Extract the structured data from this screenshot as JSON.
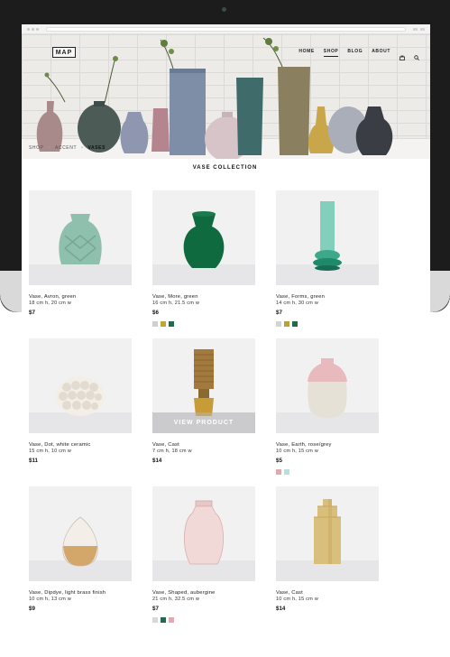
{
  "site": {
    "logo": "MAP",
    "nav": [
      {
        "label": "HOME",
        "active": false
      },
      {
        "label": "SHOP",
        "active": true
      },
      {
        "label": "BLOG",
        "active": false
      },
      {
        "label": "ABOUT",
        "active": false
      }
    ]
  },
  "breadcrumb": [
    "SHOP",
    "ACCENT",
    "VASES"
  ],
  "breadcrumb_sep": "•",
  "collection_title": "VASE COLLECTION",
  "products": [
    {
      "name": "Vase, Avron, green",
      "dims": "18 cm h, 20 cm w",
      "price": "$7",
      "swatches": []
    },
    {
      "name": "Vase, More, green",
      "dims": "16 cm h, 21.5 cm w",
      "price": "$6",
      "swatches": [
        "#cfcfcf",
        "#c2a437",
        "#1f6b4f"
      ]
    },
    {
      "name": "Vase, Forms, green",
      "dims": "14 cm h, 30 cm w",
      "price": "$7",
      "swatches": [
        "#d4d4d4",
        "#b8a33a",
        "#1f6b4f"
      ]
    },
    {
      "name": "Vase, Dot, white ceramic",
      "dims": "15 cm h, 10 cm w",
      "price": "$11",
      "swatches": []
    },
    {
      "name": "Vase, Cast",
      "dims": "7 cm h, 18 cm w",
      "price": "$14",
      "swatches": [],
      "overlay": "VIEW PRODUCT"
    },
    {
      "name": "Vase, Earth, rose/grey",
      "dims": "10 cm h, 15 cm w",
      "price": "$5",
      "swatches": [
        "#e3a9ae",
        "#b9dedc"
      ]
    },
    {
      "name": "Vase, Dipdye, light brass finish",
      "dims": "10 cm h, 13 cm w",
      "price": "$9",
      "swatches": []
    },
    {
      "name": "Vase, Shaped, aubergine",
      "dims": "21 cm h, 32.5 cm w",
      "price": "$7",
      "swatches": [
        "#d8d8d8",
        "#1f6b4f",
        "#e3a9ae"
      ]
    },
    {
      "name": "Vase, Cast",
      "dims": "10 cm h, 15 cm w",
      "price": "$14",
      "swatches": []
    }
  ]
}
